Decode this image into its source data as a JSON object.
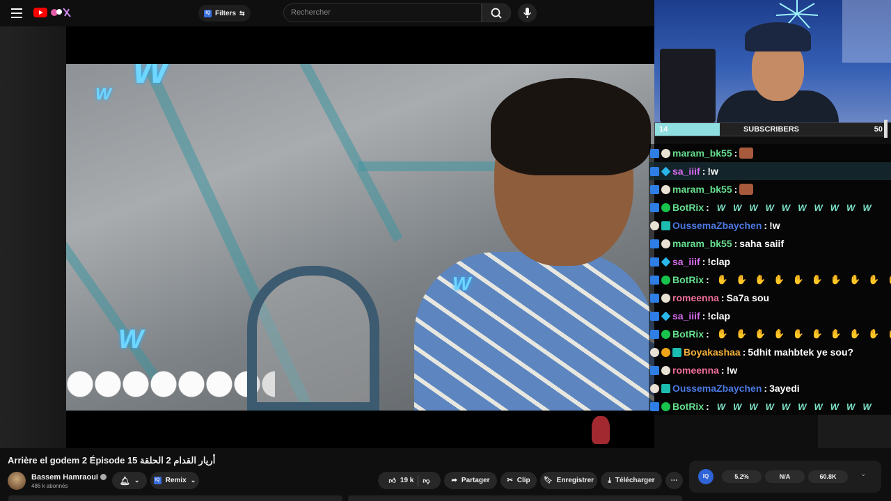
{
  "header": {
    "filters_label": "Filters",
    "search_placeholder": "Rechercher"
  },
  "video": {
    "title": "Arrière el godem 2 Épisode 15 أريار القدام 2 الحلقة",
    "channel": "Bassem Hamraoui",
    "subscribers": "486 k abonnés",
    "remix_label": "Remix",
    "likes": "19 k",
    "share_label": "Partager",
    "clip_label": "Clip",
    "save_label": "Enregistrer",
    "download_label": "Télécharger"
  },
  "stream": {
    "subscriber_goal": {
      "current": "14",
      "label": "SUBSCRIBERS",
      "target": "50",
      "progress": 0.28
    }
  },
  "chat": [
    {
      "user": "maram_bk55",
      "color": "#66e08f",
      "badges": [
        "kick",
        "face"
      ],
      "text": "",
      "emotes": "face"
    },
    {
      "user": "sa_iiif",
      "color": "#d96bf2",
      "badges": [
        "kick",
        "cube"
      ],
      "text": "!w",
      "emotes": ""
    },
    {
      "user": "maram_bk55",
      "color": "#66e08f",
      "badges": [
        "kick",
        "face"
      ],
      "text": "",
      "emotes": "face"
    },
    {
      "user": "BotRix",
      "color": "#66e08f",
      "badges": [
        "kick",
        "check"
      ],
      "text": "",
      "emotes": "w"
    },
    {
      "user": "OussemaZbaychen",
      "color": "#4b78e0",
      "badges": [
        "face",
        "gift"
      ],
      "text": "!w",
      "emotes": ""
    },
    {
      "user": "maram_bk55",
      "color": "#66e08f",
      "badges": [
        "kick",
        "face"
      ],
      "text": "saha saiif",
      "emotes": ""
    },
    {
      "user": "sa_iiif",
      "color": "#d96bf2",
      "badges": [
        "kick",
        "cube"
      ],
      "text": "!clap",
      "emotes": ""
    },
    {
      "user": "BotRix",
      "color": "#66e08f",
      "badges": [
        "kick",
        "check"
      ],
      "text": "",
      "emotes": "hand"
    },
    {
      "user": "romeenna",
      "color": "#f06f9c",
      "badges": [
        "kick",
        "face"
      ],
      "text": "Sa7a sou",
      "emotes": ""
    },
    {
      "user": "sa_iiif",
      "color": "#d96bf2",
      "badges": [
        "kick",
        "cube"
      ],
      "text": "!clap",
      "emotes": ""
    },
    {
      "user": "BotRix",
      "color": "#66e08f",
      "badges": [
        "kick",
        "check"
      ],
      "text": "",
      "emotes": "hand"
    },
    {
      "user": "Boyakashaa",
      "color": "#f5b13a",
      "badges": [
        "face",
        "warn",
        "gift"
      ],
      "text": "5dhit mahbtek ye sou?",
      "emotes": ""
    },
    {
      "user": "romeenna",
      "color": "#f06f9c",
      "badges": [
        "kick",
        "face"
      ],
      "text": "!w",
      "emotes": ""
    },
    {
      "user": "OussemaZbaychen",
      "color": "#4b78e0",
      "badges": [
        "face",
        "gift"
      ],
      "text": "3ayedi",
      "emotes": ""
    },
    {
      "user": "BotRix",
      "color": "#66e08f",
      "badges": [
        "kick",
        "check"
      ],
      "text": "",
      "emotes": "w"
    }
  ],
  "stats": {
    "iq_label": "IQ",
    "values": [
      "5.2%",
      "N/A",
      "60.8K"
    ]
  },
  "colors": {
    "accent": "#2f64d8",
    "goal_fill": "#8fdfe0"
  }
}
